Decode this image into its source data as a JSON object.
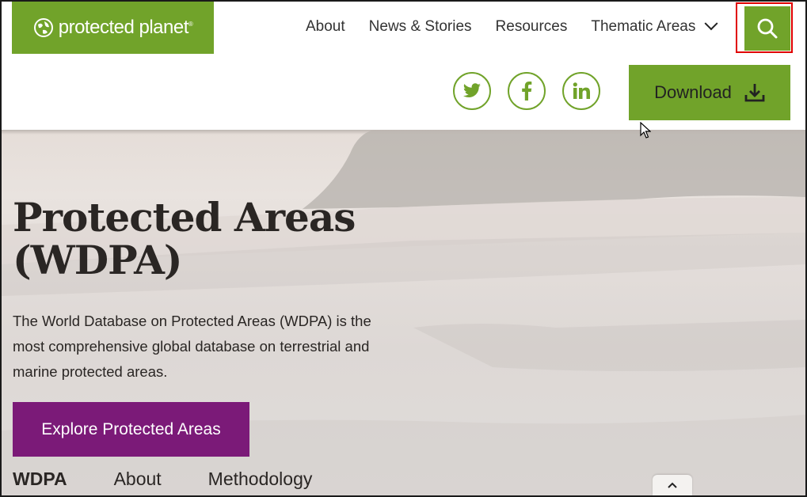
{
  "logo": {
    "text": "protected planet",
    "mark": "®"
  },
  "nav": [
    {
      "label": "About"
    },
    {
      "label": "News & Stories"
    },
    {
      "label": "Resources"
    },
    {
      "label": "Thematic Areas"
    }
  ],
  "social": [
    "twitter-icon",
    "facebook-icon",
    "linkedin-icon"
  ],
  "download": {
    "label": "Download"
  },
  "hero": {
    "title": "Protected Areas (WDPA)",
    "description": "The World Database on Protected Areas (WDPA) is the most comprehensive global database on terrestrial and marine protected areas.",
    "cta": "Explore Protected Areas"
  },
  "subnav": [
    {
      "label": "WDPA"
    },
    {
      "label": "About"
    },
    {
      "label": "Methodology"
    }
  ],
  "colors": {
    "brand_green": "#71a32a",
    "cta_purple": "#7b1a78",
    "highlight_red": "#e00000"
  }
}
